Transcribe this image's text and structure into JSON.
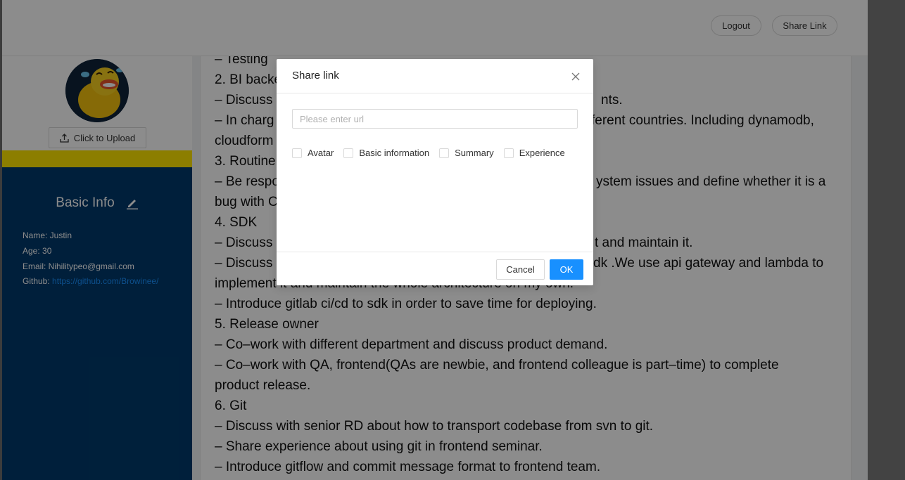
{
  "header": {
    "logout_label": "Logout",
    "share_label": "Share Link"
  },
  "sidebar": {
    "upload_label": "Click to Upload",
    "basic_info_title": "Basic Info",
    "name": "Name: Justin",
    "age": "Age: 30",
    "email": "Email: Nihilitypeo@gmail.com",
    "github_label": "Github: ",
    "github_url": "https://github.com/Browinee/"
  },
  "content": {
    "lines": [
      "– Testing",
      "2. BI backe",
      "– Discuss",
      "– In charg",
      "cloudform",
      "3. Routine",
      "– Be respo",
      "bug with C",
      "4. SDK",
      "– Discuss",
      "– Discuss",
      "implement it and maintain the whole architecture on my own.",
      "– Introduce gitlab ci/cd to sdk in order to save time for deploying.",
      "5. Release owner",
      "– Co–work with different department and discuss product demand.",
      "– Co–work with QA, frontend(QAs are newbie, and frontend colleague is part–time) to complete",
      "product release.",
      "6. Git",
      "– Discuss with senior RD about how to transport codebase from svn to git.",
      "– Share experience about using git in frontend seminar.",
      "– Introduce gitflow and commit message format to frontend team."
    ],
    "fragments": {
      "line3_tail": "nts.",
      "line4_tail": "ferent countries. Including dynamodb,",
      "line7_tail": "ystem issues and define whether it is a",
      "line10_tail": "t and maintain it.",
      "line11_tail": "dk .We use api gateway and lambda to"
    }
  },
  "modal": {
    "title": "Share link",
    "url_placeholder": "Please enter url",
    "url_value": "",
    "options": [
      "Avatar",
      "Basic information",
      "Summary",
      "Experience"
    ],
    "cancel_label": "Cancel",
    "ok_label": "OK"
  },
  "colors": {
    "primary": "#1890ff",
    "sidebar_bg": "#003a6c",
    "accent_yellow": "#ffe600"
  }
}
